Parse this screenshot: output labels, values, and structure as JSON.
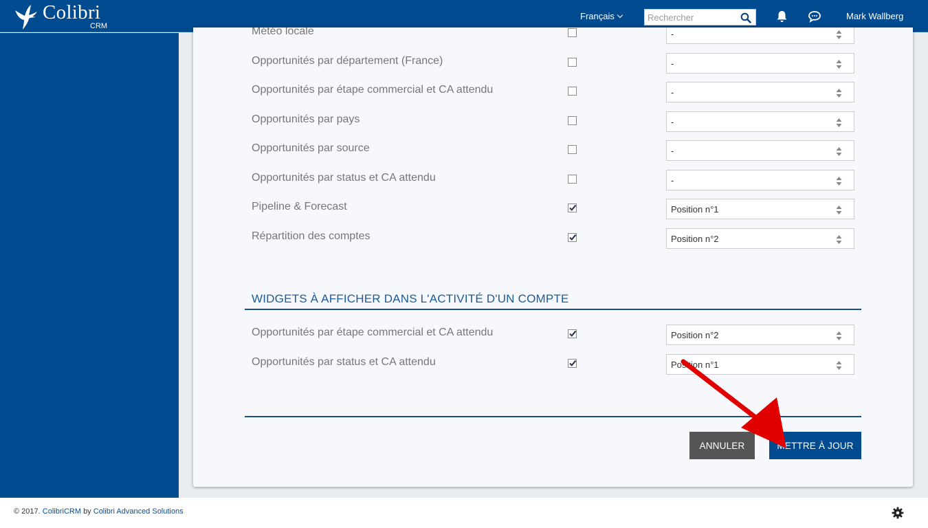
{
  "header": {
    "logo_name": "Colibri",
    "logo_sub": "CRM",
    "language": "Français",
    "search_placeholder": "Rechercher",
    "user_name": "Mark Wallberg"
  },
  "dashboard_widgets": [
    {
      "label": "Météo locale",
      "checked": false,
      "position": "-"
    },
    {
      "label": "Opportunités par département (France)",
      "checked": false,
      "position": "-"
    },
    {
      "label": "Opportunités par étape commercial et CA attendu",
      "checked": false,
      "position": "-"
    },
    {
      "label": "Opportunités par pays",
      "checked": false,
      "position": "-"
    },
    {
      "label": "Opportunités par source",
      "checked": false,
      "position": "-"
    },
    {
      "label": "Opportunités par status et CA attendu",
      "checked": false,
      "position": "-"
    },
    {
      "label": "Pipeline & Forecast",
      "checked": true,
      "position": "Position n°1"
    },
    {
      "label": "Répartition des comptes",
      "checked": true,
      "position": "Position n°2"
    }
  ],
  "account_section": {
    "title": "WIDGETS À AFFICHER DANS L'ACTIVITÉ D'UN COMPTE",
    "widgets": [
      {
        "label": "Opportunités par étape commercial et CA attendu",
        "checked": true,
        "position": "Position n°2"
      },
      {
        "label": "Opportunités par status et CA attendu",
        "checked": true,
        "position": "Position n°1"
      }
    ]
  },
  "actions": {
    "cancel_label": "ANNULER",
    "save_label": "METTRE À JOUR"
  },
  "footer": {
    "year_text": "© 2017.",
    "product_link": "ColibriCRM",
    "by_text": "by",
    "company_link": "Colibri Advanced Solutions"
  },
  "colors": {
    "brand_blue": "#004a8f",
    "cancel_gray": "#555555",
    "annotation_red": "#e00000"
  }
}
